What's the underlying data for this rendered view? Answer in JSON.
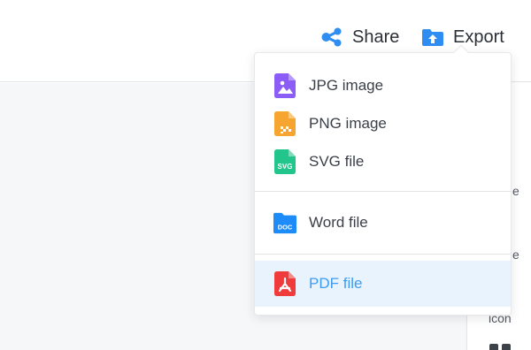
{
  "toolbar": {
    "share_label": "Share",
    "export_label": "Export",
    "share_icon": "share-icon",
    "export_icon": "export-icon",
    "accent": "#3d9cf0"
  },
  "export_menu": {
    "items": [
      {
        "label": "JPG image",
        "icon": "jpg-file-icon",
        "color": "#8b5cf6"
      },
      {
        "label": "PNG image",
        "icon": "png-file-icon",
        "color": "#f7a531"
      },
      {
        "label": "SVG file",
        "icon": "svg-file-icon",
        "color": "#22c58b",
        "badge": "SVG"
      },
      {
        "label": "Word file",
        "icon": "word-file-icon",
        "color": "#1d8cf8",
        "badge": "DOC"
      },
      {
        "label": "PDF file",
        "icon": "pdf-file-icon",
        "color": "#ef3b3b",
        "highlighted": true
      }
    ]
  },
  "right_panel": {
    "text_1": "e",
    "text_2": "e",
    "text_3": "icon"
  }
}
